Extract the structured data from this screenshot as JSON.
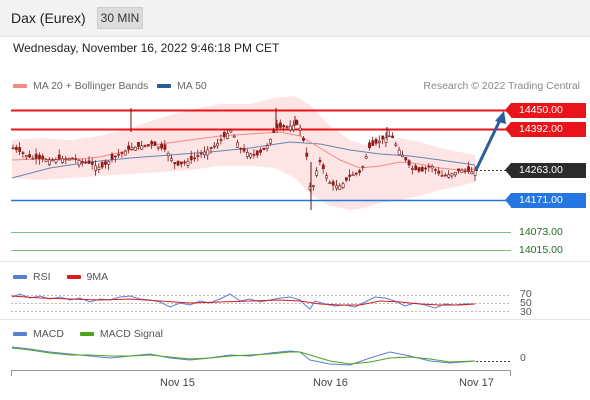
{
  "header": {
    "instrument": "Dax (Eurex)",
    "timeframe": "30 MIN"
  },
  "timestamp": "Wednesday, November 16, 2022 9:46:18 PM CET",
  "legend": {
    "items": [
      {
        "label": "MA 20 + Bollinger Bands",
        "color": "#f28b82"
      },
      {
        "label": "MA 50",
        "color": "#2b5d9b"
      }
    ],
    "copyright": "Research © 2022 Trading Central"
  },
  "levels": {
    "r2": "14450.00",
    "r1": "14392.00",
    "last": "14263.00",
    "s1": "14171.00",
    "s2": "14073.00",
    "s3": "14015.00"
  },
  "rsi": {
    "legend": [
      {
        "label": "RSI",
        "color": "#5b7fd8"
      },
      {
        "label": "9MA",
        "color": "#d81b1b"
      }
    ],
    "levels": [
      "70",
      "50",
      "30"
    ]
  },
  "macd": {
    "legend": [
      {
        "label": "MACD",
        "color": "#5b7fd8"
      },
      {
        "label": "MACD Signal",
        "color": "#4ea31b"
      }
    ],
    "zero_label": "0"
  },
  "x_axis": {
    "dates": [
      "Nov 15",
      "Nov 16",
      "Nov 17"
    ]
  },
  "colors": {
    "resistance": "#e8141a",
    "support": "#2576e0",
    "target": "#1f6e1f",
    "bull_candle": "#6b0f0f",
    "bear_candle": "#8f1a1a",
    "bollinger_fill": "#fde0e0",
    "arrow": "#2b5d9b"
  }
}
